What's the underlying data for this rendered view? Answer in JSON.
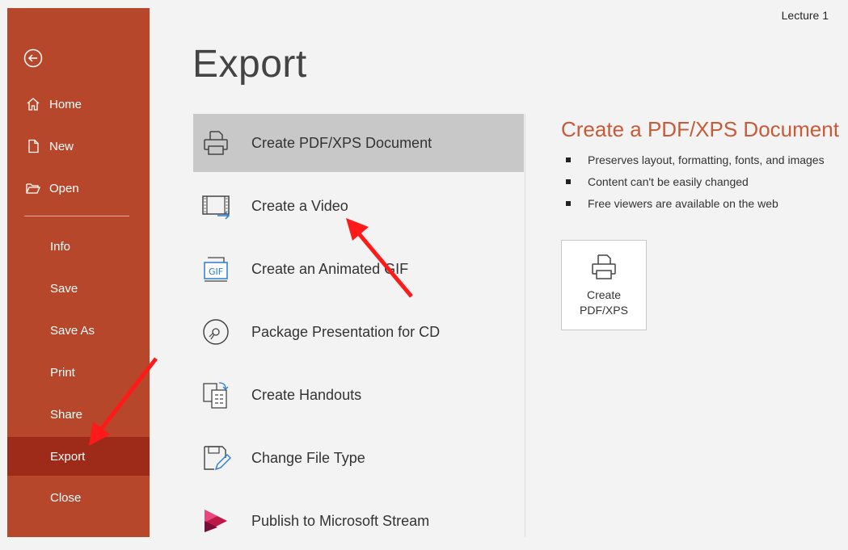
{
  "window": {
    "doc_title": "Lecture 1"
  },
  "sidebar": {
    "back_icon": "back-arrow-circle-icon",
    "items": [
      {
        "label": "Home",
        "icon": "home-icon"
      },
      {
        "label": "New",
        "icon": "new-document-icon"
      },
      {
        "label": "Open",
        "icon": "open-folder-icon"
      },
      {
        "label": "Info"
      },
      {
        "label": "Save"
      },
      {
        "label": "Save As"
      },
      {
        "label": "Print"
      },
      {
        "label": "Share"
      },
      {
        "label": "Export",
        "active": true
      },
      {
        "label": "Close"
      }
    ],
    "colors": {
      "background": "#b7472a",
      "active": "#9e2a1a"
    }
  },
  "main": {
    "title": "Export",
    "options": [
      {
        "label": "Create PDF/XPS Document",
        "icon": "pdf-xps-printer-icon",
        "selected": true
      },
      {
        "label": "Create a Video",
        "icon": "video-film-icon"
      },
      {
        "label": "Create an Animated GIF",
        "icon": "gif-icon"
      },
      {
        "label": "Package Presentation for CD",
        "icon": "cd-disc-icon"
      },
      {
        "label": "Create Handouts",
        "icon": "handouts-icon"
      },
      {
        "label": "Change File Type",
        "icon": "change-file-type-icon"
      },
      {
        "label": "Publish to Microsoft Stream",
        "icon": "microsoft-stream-icon"
      }
    ]
  },
  "detail": {
    "title": "Create a PDF/XPS Document",
    "bullets": [
      "Preserves layout, formatting, fonts, and images",
      "Content can't be easily changed",
      "Free viewers are available on the web"
    ],
    "button": {
      "line1": "Create",
      "line2": "PDF/XPS"
    },
    "accent_color": "#c75b39"
  }
}
